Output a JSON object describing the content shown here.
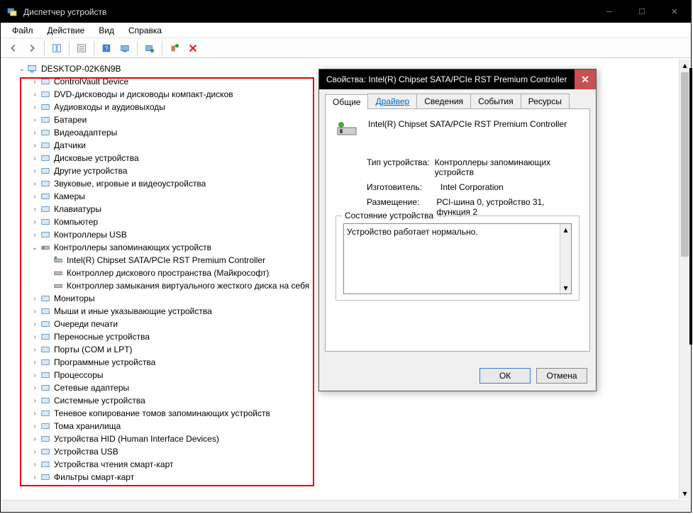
{
  "window": {
    "title": "Диспетчер устройств"
  },
  "menu": {
    "file": "Файл",
    "action": "Действие",
    "view": "Вид",
    "help": "Справка"
  },
  "tree": {
    "root": "DESKTOP-02K6N9B",
    "items": [
      "ControlVault Device",
      "DVD-дисководы и дисководы компакт-дисков",
      "Аудиовходы и аудиовыходы",
      "Батареи",
      "Видеоадаптеры",
      "Датчики",
      "Дисковые устройства",
      "Другие устройства",
      "Звуковые, игровые и видеоустройства",
      "Камеры",
      "Клавиатуры",
      "Компьютер",
      "Контроллеры USB"
    ],
    "storage_controllers": {
      "label": "Контроллеры запоминающих устройств",
      "children": [
        "Intel(R) Chipset SATA/PCIe RST Premium Controller",
        "Контроллер дискового пространства (Майкрософт)",
        "Контроллер замыкания виртуального жесткого диска на себя"
      ]
    },
    "rest": [
      "Мониторы",
      "Мыши и иные указывающие устройства",
      "Очереди печати",
      "Переносные устройства",
      "Порты (COM и LPT)",
      "Программные устройства",
      "Процессоры",
      "Сетевые адаптеры",
      "Системные устройства",
      "Теневое копирование томов запоминающих устройств",
      "Тома хранилища",
      "Устройства HID (Human Interface Devices)",
      "Устройства USB",
      "Устройства чтения смарт-карт",
      "Фильтры смарт-карт"
    ]
  },
  "dialog": {
    "title": "Свойства: Intel(R) Chipset SATA/PCIe RST Premium Controller",
    "tabs": {
      "general": "Общие",
      "driver": "Драйвер",
      "details": "Сведения",
      "events": "События",
      "resources": "Ресурсы"
    },
    "device_name": "Intel(R) Chipset SATA/PCIe RST Premium Controller",
    "type_label": "Тип устройства:",
    "type_value": "Контроллеры запоминающих устройств",
    "mfg_label": "Изготовитель:",
    "mfg_value": "Intel Corporation",
    "loc_label": "Размещение:",
    "loc_value": "PCI-шина 0, устройство 31, функция 2",
    "status_legend": "Состояние устройства",
    "status_text": "Устройство работает нормально.",
    "ok": "ОК",
    "cancel": "Отмена"
  }
}
